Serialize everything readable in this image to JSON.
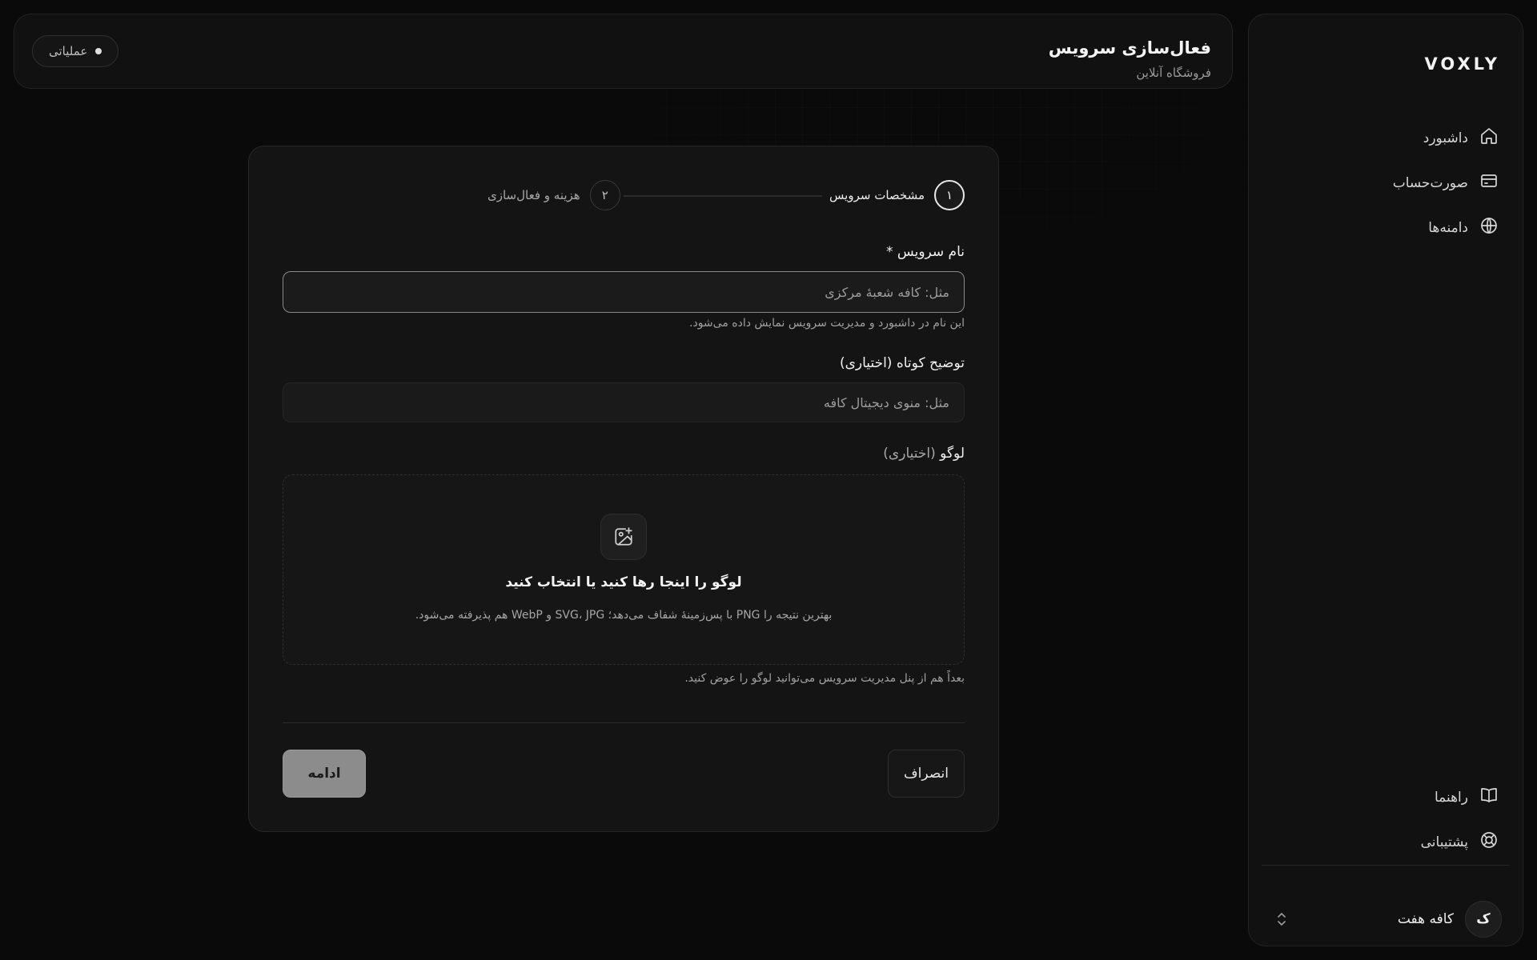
{
  "sidebar": {
    "brand": "VOXLY",
    "nav": [
      {
        "label": "داشبورد",
        "icon": "home-icon"
      },
      {
        "label": "صورت‌حساب",
        "icon": "credit-card-icon"
      },
      {
        "label": "دامنه‌ها",
        "icon": "globe-icon"
      }
    ],
    "footer_nav": [
      {
        "label": "راهنما",
        "icon": "book-icon"
      },
      {
        "label": "پشتیبانی",
        "icon": "lifebuoy-icon"
      }
    ],
    "account": {
      "avatar_letter": "ک",
      "name": "کافه هفت",
      "switch_icon": "chevrons-up-down-icon"
    }
  },
  "header": {
    "title": "فعال‌سازی سرویس",
    "subtitle": "فروشگاه آنلاین",
    "env_badge": "عملیاتی"
  },
  "stepper": {
    "steps": [
      {
        "number": "۱",
        "label": "مشخصات سرویس",
        "state": "active"
      },
      {
        "number": "۲",
        "label": "هزینه و فعال‌سازی",
        "state": "idle"
      }
    ]
  },
  "form": {
    "service_name": {
      "label": "نام سرویس *",
      "placeholder": "مثل: کافه شعبهٔ مرکزی",
      "value": "",
      "hint": "این نام در داشبورد و مدیریت سرویس نمایش داده می‌شود."
    },
    "description": {
      "label": "توضیح کوتاه",
      "optional": "(اختیاری)",
      "placeholder": "مثل: منوی دیجیتال کافه",
      "value": ""
    },
    "logo": {
      "label": "لوگو",
      "optional": "(اختیاری)",
      "dropzone_icon": "image-plus-icon",
      "dropzone_title": "لوگو را اینجا رها کنید یا انتخاب کنید",
      "dropzone_subtitle": "بهترین نتیجه را PNG با پس‌زمینهٔ شفاف می‌دهد؛ SVG، JPG و WebP هم پذیرفته می‌شود.",
      "hint": "بعداً هم از پنل مدیریت سرویس می‌توانید لوگو را عوض کنید."
    }
  },
  "actions": {
    "cancel": "انصراف",
    "continue": "ادامه"
  },
  "colors": {
    "background": "#0a0a0a",
    "panel": "#111111",
    "card": "#141414",
    "primary_button_disabled": "#8c8c8c"
  }
}
